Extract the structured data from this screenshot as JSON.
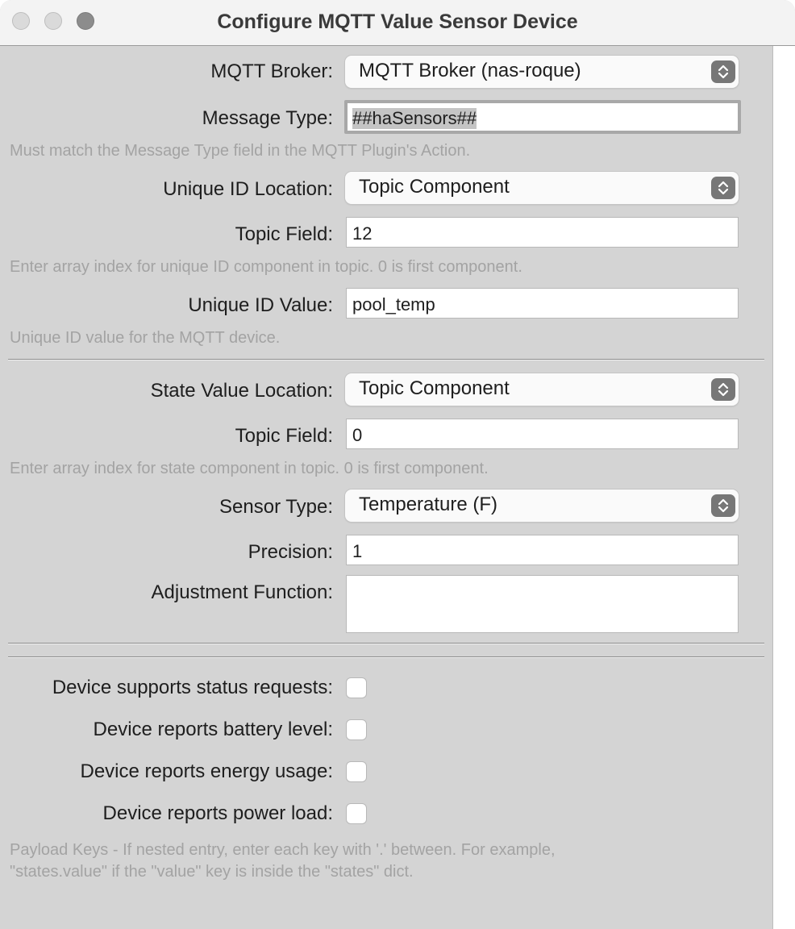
{
  "window": {
    "title": "Configure MQTT Value Sensor Device"
  },
  "form": {
    "broker": {
      "label": "MQTT Broker:",
      "value": "MQTT Broker (nas-roque)"
    },
    "message_type": {
      "label": "Message Type:",
      "value": "##haSensors##",
      "hint": "Must match the Message Type field in the MQTT Plugin's Action."
    },
    "uid_location": {
      "label": "Unique ID Location:",
      "value": "Topic Component"
    },
    "uid_topic_field": {
      "label": "Topic Field:",
      "value": "12",
      "hint": "Enter array index for unique ID component in topic.  0 is first component."
    },
    "uid_value": {
      "label": "Unique ID Value:",
      "value": "pool_temp",
      "hint": "Unique ID value for the MQTT device."
    },
    "state_location": {
      "label": "State Value Location:",
      "value": "Topic Component"
    },
    "state_topic_field": {
      "label": "Topic Field:",
      "value": "0",
      "hint": "Enter array index for state component in topic.  0 is first component."
    },
    "sensor_type": {
      "label": "Sensor Type:",
      "value": "Temperature (F)"
    },
    "precision": {
      "label": "Precision:",
      "value": "1"
    },
    "adjustment": {
      "label": "Adjustment Function:",
      "value": ""
    },
    "checkboxes": [
      {
        "label": "Device supports status requests:",
        "checked": false
      },
      {
        "label": "Device reports battery level:",
        "checked": false
      },
      {
        "label": "Device reports energy usage:",
        "checked": false
      },
      {
        "label": "Device reports power load:",
        "checked": false
      }
    ],
    "payload_hint_line1": "Payload Keys - If nested entry, enter each key with '.' between.  For example,",
    "payload_hint_line2": "\"states.value\" if the \"value\" key is inside the \"states\" dict."
  },
  "icons": {
    "window_controls": [
      "close-icon",
      "minimize-icon",
      "zoom-icon"
    ],
    "popup_indicator": "chevron-updown-icon"
  },
  "colors": {
    "window_bg": "#d4d4d4",
    "titlebar_bg": "#f3f3f3",
    "hint_text": "#a3a3a3",
    "stepper": "#777777"
  }
}
